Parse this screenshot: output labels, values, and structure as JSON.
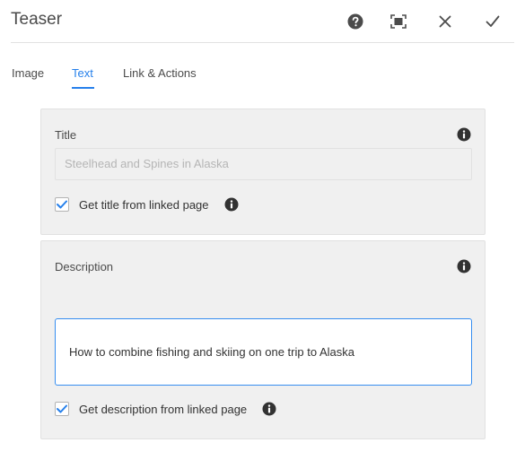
{
  "dialog": {
    "title": "Teaser",
    "icons": {
      "help": "help-icon",
      "fullscreen": "fullscreen-icon",
      "close": "close-icon",
      "confirm": "checkmark-icon"
    }
  },
  "tabs": [
    {
      "label": "Image",
      "active": false
    },
    {
      "label": "Text",
      "active": true
    },
    {
      "label": "Link & Actions",
      "active": false
    }
  ],
  "title_panel": {
    "label": "Title",
    "placeholder": "Steelhead and Spines in Alaska",
    "checkbox_label": "Get title from linked page",
    "checkbox_checked": true
  },
  "description_panel": {
    "label": "Description",
    "value": "How to combine fishing and skiing on one trip to Alaska",
    "checkbox_label": "Get description from linked page",
    "checkbox_checked": true
  },
  "colors": {
    "accent": "#2680eb",
    "panel_bg": "#f0f0f0",
    "text": "#4b4b4b"
  }
}
